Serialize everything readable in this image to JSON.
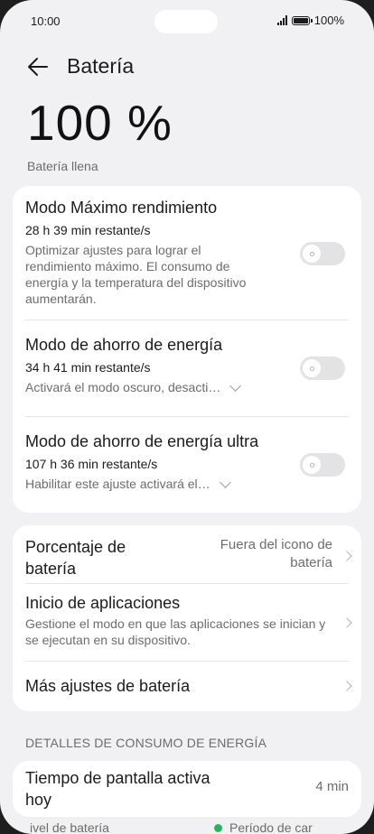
{
  "status_bar": {
    "time": "10:00",
    "battery_text": "100%",
    "icons": [
      "signal-icon",
      "battery-icon"
    ]
  },
  "header": {
    "back_icon": "back-arrow-icon",
    "title": "Batería"
  },
  "battery": {
    "percent_text": "100 %",
    "status": "Batería llena"
  },
  "modes": [
    {
      "title": "Modo Máximo rendimiento",
      "remaining": "28 h 39 min restante/s",
      "description": "Optimizar ajustes para lograr el rendimiento máximo. El consumo de energía y la temperatura del dispositivo aumentarán.",
      "enabled": false
    },
    {
      "title": "Modo de ahorro de energía",
      "remaining": "34 h 41 min restante/s",
      "description": "Activará el modo oscuro, desacti…",
      "enabled": false
    },
    {
      "title": "Modo de ahorro de energía ultra",
      "remaining": "107 h 36 min restante/s",
      "description": "Habilitar este ajuste activará el…",
      "enabled": false
    }
  ],
  "settings": [
    {
      "title": "Porcentaje de batería",
      "value": "Fuera del icono de batería"
    },
    {
      "title": "Inicio de aplicaciones",
      "subtitle": "Gestione el modo en que las aplicaciones se inician y se ejecutan en su dispositivo."
    },
    {
      "title": "Más ajustes de batería"
    }
  ],
  "consumption": {
    "section_label": "DETALLES DE CONSUMO DE ENERGÍA",
    "screen_time_title": "Tiempo de pantalla activa hoy",
    "screen_time_value": "4 min",
    "legend_left": "ivel de batería",
    "legend_right": "Período de car",
    "legend_color": "#28b45a"
  },
  "colors": {
    "background": "#f1f1f3",
    "card": "#ffffff",
    "secondary_text": "#6c6c6c",
    "toggle_off": "#e3e3e6"
  }
}
